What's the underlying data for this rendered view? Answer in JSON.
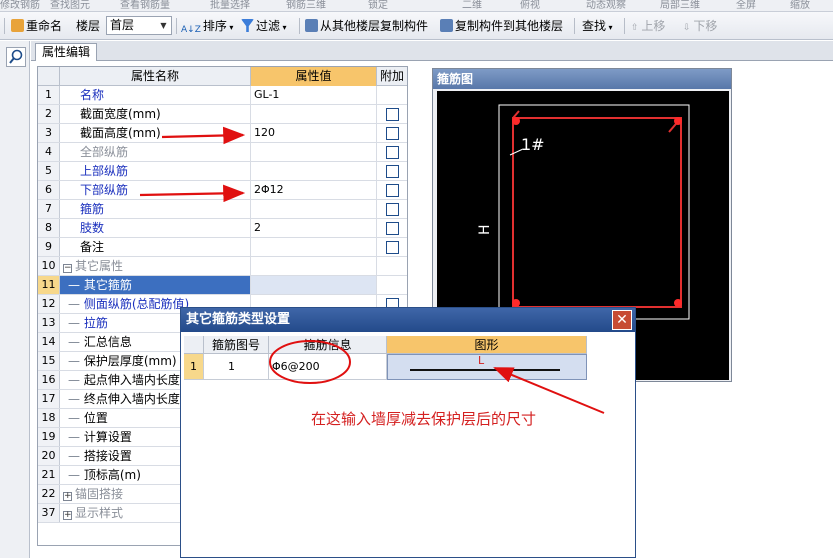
{
  "toolbar_top": {
    "items": [
      "修改钢筋",
      "查找图元",
      "查看钢筋量",
      "批量选择",
      "钢筋三维",
      "锁定",
      "二维",
      "俯视",
      "动态观察",
      "局部三维",
      "全屏",
      "缩放"
    ]
  },
  "toolbar": {
    "rename_label": "重命名",
    "floor_label": "楼层",
    "floor_value": "首层",
    "sort_label": "排序",
    "filter_label": "过滤",
    "copy_from_label": "从其他楼层复制构件",
    "copy_to_label": "复制构件到其他楼层",
    "find_label": "查找",
    "up_label": "上移",
    "down_label": "下移"
  },
  "tab": {
    "label": "属性编辑"
  },
  "grid": {
    "headers": {
      "name": "属性名称",
      "value": "属性值",
      "add": "附加"
    },
    "rows": [
      {
        "num": "1",
        "name": "名称",
        "value": "GL-1",
        "style": "blue",
        "check": false
      },
      {
        "num": "2",
        "name": "截面宽度(mm)",
        "value": "",
        "style": "",
        "check": true
      },
      {
        "num": "3",
        "name": "截面高度(mm)",
        "value": "120",
        "style": "",
        "check": true
      },
      {
        "num": "4",
        "name": "全部纵筋",
        "value": "",
        "style": "gray",
        "check": true
      },
      {
        "num": "5",
        "name": "上部纵筋",
        "value": "",
        "style": "blue",
        "check": true
      },
      {
        "num": "6",
        "name": "下部纵筋",
        "value": "2Φ12",
        "style": "blue",
        "check": true
      },
      {
        "num": "7",
        "name": "箍筋",
        "value": "",
        "style": "blue",
        "check": true
      },
      {
        "num": "8",
        "name": "肢数",
        "value": "2",
        "style": "blue",
        "check": true
      },
      {
        "num": "9",
        "name": "备注",
        "value": "",
        "style": "",
        "check": true
      },
      {
        "num": "10",
        "name": "其它属性",
        "value": "",
        "style": "gray",
        "check": false
      },
      {
        "num": "11",
        "name": "其它箍筋",
        "value": "",
        "style": "tree",
        "check": false
      },
      {
        "num": "12",
        "name": "侧面纵筋(总配筋值)",
        "value": "",
        "style": "blue",
        "check": true
      },
      {
        "num": "13",
        "name": "拉筋",
        "value": "",
        "style": "blue",
        "check": false
      },
      {
        "num": "14",
        "name": "汇总信息",
        "value": "",
        "style": "",
        "check": false
      },
      {
        "num": "15",
        "name": "保护层厚度(mm)",
        "value": "",
        "style": "",
        "check": false
      },
      {
        "num": "16",
        "name": "起点伸入墙内长度",
        "value": "",
        "style": "",
        "check": false
      },
      {
        "num": "17",
        "name": "终点伸入墙内长度",
        "value": "",
        "style": "",
        "check": false
      },
      {
        "num": "18",
        "name": "位置",
        "value": "",
        "style": "",
        "check": false
      },
      {
        "num": "19",
        "name": "计算设置",
        "value": "",
        "style": "",
        "check": false
      },
      {
        "num": "20",
        "name": "搭接设置",
        "value": "",
        "style": "",
        "check": false
      },
      {
        "num": "21",
        "name": "顶标高(m)",
        "value": "",
        "style": "",
        "check": false
      },
      {
        "num": "22",
        "name": "锚固搭接",
        "value": "",
        "style": "gray",
        "check": false
      },
      {
        "num": "37",
        "name": "显示样式",
        "value": "",
        "style": "gray",
        "check": false
      }
    ]
  },
  "preview": {
    "title": "箍筋图",
    "label_1": "1#",
    "label_h": "H"
  },
  "dialog": {
    "title": "其它箍筋类型设置",
    "close": "✕",
    "headers": {
      "shape_no": "箍筋图号",
      "info": "箍筋信息",
      "figure": "图形"
    },
    "row": {
      "num": "1",
      "shape_no": "1",
      "info": "Φ6@200",
      "figure_label": "L"
    }
  },
  "annotation": {
    "text": "在这输入墙厚减去保护层后的尺寸"
  },
  "colors": {
    "accent_red": "#d42020",
    "selected_row": "#3c6fc0",
    "value_header": "#f7c56b",
    "dialog_title": "#2d5597"
  }
}
